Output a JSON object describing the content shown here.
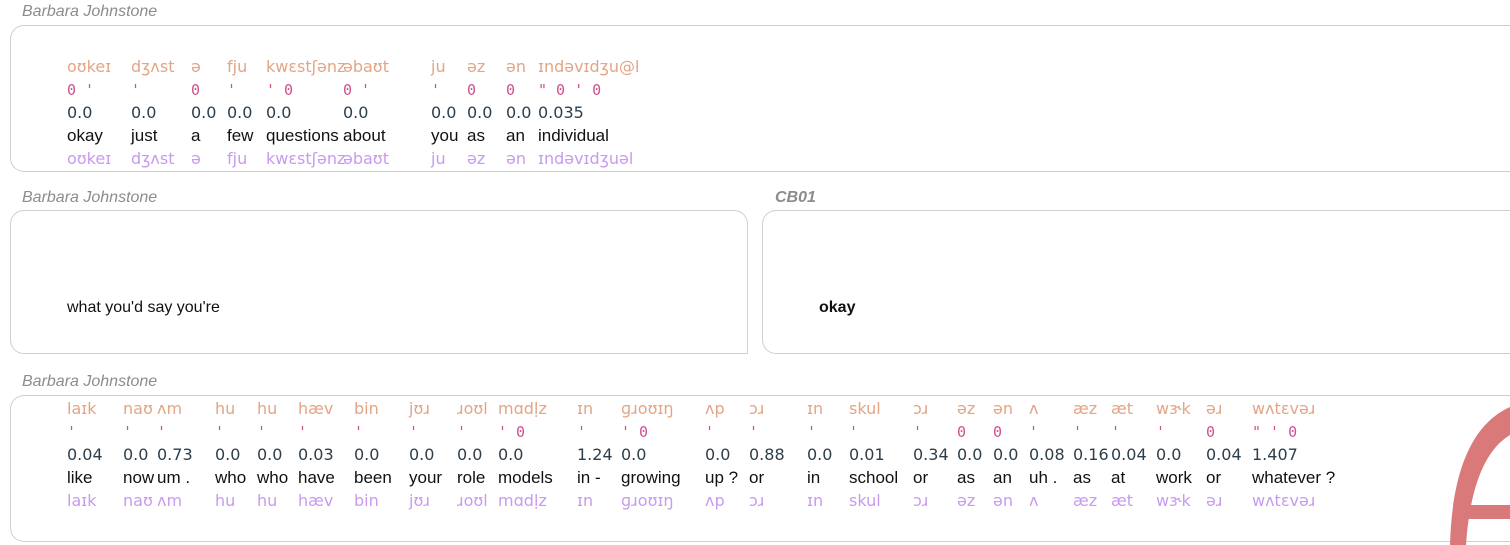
{
  "segments": [
    {
      "speaker": "Barbara Johnstone",
      "ipa": [
        {
          "t": "oʊkeɪ"
        },
        {
          "t": "dʒʌst"
        },
        {
          "t": "ə"
        },
        {
          "t": "fju"
        },
        {
          "t": "kwɛstʃənz"
        },
        {
          "t": "əbaʊt"
        },
        {
          "t": "ju"
        },
        {
          "t": "əz"
        },
        {
          "t": "ən"
        },
        {
          "t": "ɪndəvɪdʒu@l"
        }
      ],
      "stress": [
        {
          "t": "0 '"
        },
        {
          "t": "'"
        },
        {
          "t": "0"
        },
        {
          "t": "'"
        },
        {
          "t": "' 0"
        },
        {
          "t": "0 '"
        },
        {
          "t": "'"
        },
        {
          "t": "0"
        },
        {
          "t": "0"
        },
        {
          "t": "\" 0 ' 0"
        }
      ],
      "numbers": [
        {
          "t": "0.0"
        },
        {
          "t": "0.0"
        },
        {
          "t": "0.0"
        },
        {
          "t": "0.0"
        },
        {
          "t": "0.0"
        },
        {
          "t": "0.0"
        },
        {
          "t": "0.0"
        },
        {
          "t": "0.0"
        },
        {
          "t": "0.0"
        },
        {
          "t": "0.035"
        }
      ],
      "words": [
        {
          "t": "okay"
        },
        {
          "t": "just"
        },
        {
          "t": "a"
        },
        {
          "t": "few"
        },
        {
          "t": "questions"
        },
        {
          "t": "about"
        },
        {
          "t": "you"
        },
        {
          "t": "as"
        },
        {
          "t": "an"
        },
        {
          "t": "individual"
        }
      ],
      "ipa2": [
        {
          "t": "oʊkeɪ"
        },
        {
          "t": "dʒʌst"
        },
        {
          "t": "ə"
        },
        {
          "t": "fju"
        },
        {
          "t": "kwɛstʃənz"
        },
        {
          "t": "əbaʊt"
        },
        {
          "t": "ju"
        },
        {
          "t": "əz"
        },
        {
          "t": "ən"
        },
        {
          "t": "ɪndəvɪdʒuəl"
        }
      ]
    },
    {
      "speaker": "Barbara Johnstone",
      "text": "what you'd say you're"
    },
    {
      "speaker": "CB01",
      "text": "okay"
    },
    {
      "speaker": "Barbara Johnstone",
      "ipa": [
        {
          "t": "laɪk"
        },
        {
          "t": "naʊ"
        },
        {
          "t": "ʌm"
        },
        {
          "t": "hu"
        },
        {
          "t": "hu"
        },
        {
          "t": "hæv"
        },
        {
          "t": "bin"
        },
        {
          "t": "jʊɹ"
        },
        {
          "t": "ɹoʊl"
        },
        {
          "t": "mɑdḷz"
        },
        {
          "t": "ɪn"
        },
        {
          "t": "ɡɹoʊɪŋ"
        },
        {
          "t": "ʌp"
        },
        {
          "t": "ɔɹ"
        },
        {
          "t": "ɪn"
        },
        {
          "t": "skul"
        },
        {
          "t": "ɔɹ"
        },
        {
          "t": "əz"
        },
        {
          "t": "ən"
        },
        {
          "t": "ʌ"
        },
        {
          "t": "æz"
        },
        {
          "t": "æt"
        },
        {
          "t": "wɝk"
        },
        {
          "t": "əɹ"
        },
        {
          "t": "wʌtɛvəɹ"
        }
      ],
      "stress": [
        {
          "t": "'"
        },
        {
          "t": "'"
        },
        {
          "t": "'"
        },
        {
          "t": "'"
        },
        {
          "t": "'"
        },
        {
          "t": "'"
        },
        {
          "t": "'"
        },
        {
          "t": "'"
        },
        {
          "t": "'"
        },
        {
          "t": "' 0"
        },
        {
          "t": "'"
        },
        {
          "t": "' 0"
        },
        {
          "t": "'"
        },
        {
          "t": "'"
        },
        {
          "t": "'"
        },
        {
          "t": "'"
        },
        {
          "t": "'"
        },
        {
          "t": "0"
        },
        {
          "t": "0"
        },
        {
          "t": "'"
        },
        {
          "t": "'"
        },
        {
          "t": "'"
        },
        {
          "t": "'"
        },
        {
          "t": "0"
        },
        {
          "t": "\" ' 0"
        }
      ],
      "numbers": [
        {
          "t": "0.04"
        },
        {
          "t": "0.0"
        },
        {
          "t": "0.73"
        },
        {
          "t": "0.0"
        },
        {
          "t": "0.0"
        },
        {
          "t": "0.03"
        },
        {
          "t": "0.0"
        },
        {
          "t": "0.0"
        },
        {
          "t": "0.0"
        },
        {
          "t": "0.0"
        },
        {
          "t": "1.24"
        },
        {
          "t": "0.0"
        },
        {
          "t": "0.0"
        },
        {
          "t": "0.88"
        },
        {
          "t": "0.0"
        },
        {
          "t": "0.01"
        },
        {
          "t": "0.34"
        },
        {
          "t": "0.0"
        },
        {
          "t": "0.0"
        },
        {
          "t": "0.08"
        },
        {
          "t": "0.16"
        },
        {
          "t": "0.04"
        },
        {
          "t": "0.0"
        },
        {
          "t": "0.04"
        },
        {
          "t": "1.407"
        }
      ],
      "words": [
        {
          "t": "like"
        },
        {
          "t": "now"
        },
        {
          "t": "um ."
        },
        {
          "t": "who"
        },
        {
          "t": "who"
        },
        {
          "t": "have"
        },
        {
          "t": "been"
        },
        {
          "t": "your"
        },
        {
          "t": "role"
        },
        {
          "t": "models"
        },
        {
          "t": "in -"
        },
        {
          "t": "growing"
        },
        {
          "t": "up ?"
        },
        {
          "t": "or"
        },
        {
          "t": "in"
        },
        {
          "t": "school"
        },
        {
          "t": "or"
        },
        {
          "t": "as"
        },
        {
          "t": "an"
        },
        {
          "t": "uh ."
        },
        {
          "t": "as"
        },
        {
          "t": "at"
        },
        {
          "t": "work"
        },
        {
          "t": "or"
        },
        {
          "t": "whatever ?"
        }
      ],
      "ipa2": [
        {
          "t": "laɪk"
        },
        {
          "t": "naʊ"
        },
        {
          "t": "ʌm"
        },
        {
          "t": "hu"
        },
        {
          "t": "hu"
        },
        {
          "t": "hæv"
        },
        {
          "t": "bin"
        },
        {
          "t": "jʊɹ"
        },
        {
          "t": "ɹoʊl"
        },
        {
          "t": "mɑdḷz"
        },
        {
          "t": "ɪn"
        },
        {
          "t": "ɡɹoʊɪŋ"
        },
        {
          "t": "ʌp"
        },
        {
          "t": "ɔɹ"
        },
        {
          "t": "ɪn"
        },
        {
          "t": "skul"
        },
        {
          "t": "ɔɹ"
        },
        {
          "t": "əz"
        },
        {
          "t": "ən"
        },
        {
          "t": "ʌ"
        },
        {
          "t": "æz"
        },
        {
          "t": "æt"
        },
        {
          "t": "wɝk"
        },
        {
          "t": "əɹ"
        },
        {
          "t": "wʌtɛvəɹ"
        }
      ]
    }
  ],
  "colors": {
    "ipa": "#e3a585",
    "stress": "#d2508f",
    "numbers": "#2d3e4b",
    "words": "#111111",
    "ipa2": "#c89af0",
    "logo": "#d9797a"
  },
  "icons": {
    "corner_logo": "red-arc-logo-icon"
  }
}
